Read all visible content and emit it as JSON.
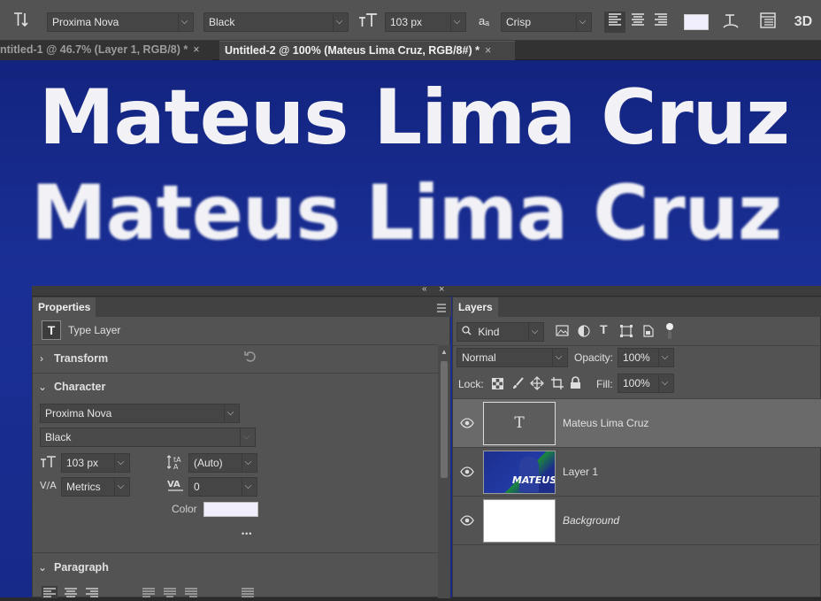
{
  "options_bar": {
    "font_family": "Proxima Nova",
    "font_style": "Black",
    "font_size": "103 px",
    "antialias_label": "aₐ",
    "antialias": "Crisp",
    "text_color": "#f0eefc",
    "three_d": "3D"
  },
  "tabs": [
    {
      "label": "ntitled-1 @ 46.7% (Layer 1, RGB/8) *",
      "close": "×"
    },
    {
      "label": "Untitled-2 @ 100% (Mateus Lima Cruz, RGB/8#) *",
      "close": "×"
    }
  ],
  "canvas": {
    "line1": "Mateus Lima Cruz",
    "line2": "Mateus Lima Cruz",
    "background_color": "#1a2d90"
  },
  "properties": {
    "tab": "Properties",
    "layer_type": "Type Layer",
    "transform": "Transform",
    "character": "Character",
    "font_family": "Proxima Nova",
    "font_style": "Black",
    "size": "103 px",
    "leading": "(Auto)",
    "kerning": "Metrics",
    "tracking": "0",
    "color_label": "Color",
    "color": "#f0eefc",
    "more": "•••",
    "paragraph": "Paragraph"
  },
  "layers": {
    "tab": "Layers",
    "filter": "Kind",
    "blend_mode": "Normal",
    "opacity_label": "Opacity:",
    "opacity": "100%",
    "lock_label": "Lock:",
    "fill_label": "Fill:",
    "fill": "100%",
    "items": [
      {
        "name": "Mateus Lima Cruz",
        "thumb": "T"
      },
      {
        "name": "Layer 1",
        "thumb_text": "MATEUS"
      },
      {
        "name": "Background"
      }
    ]
  }
}
